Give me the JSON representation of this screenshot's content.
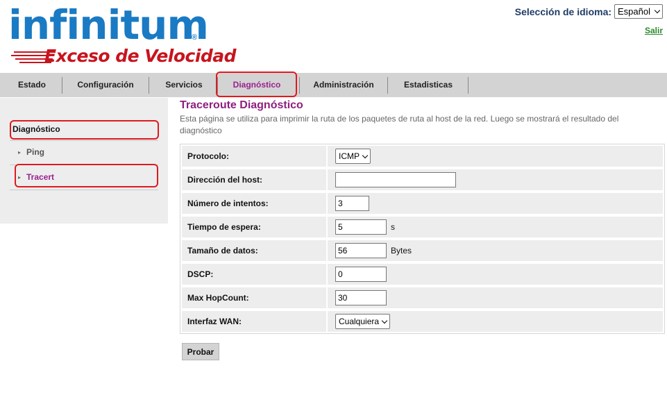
{
  "brand": {
    "name": "infinitum",
    "registered": "®",
    "tagline": "Exceso de Velocidad"
  },
  "language": {
    "label": "Selección de idioma:",
    "selected": "Español"
  },
  "logout_label": "Salir",
  "nav": [
    "Estado",
    "Configuración",
    "Servicios",
    "Diagnóstico",
    "Administración",
    "Estadisticas"
  ],
  "sidebar": {
    "title": "Diagnóstico",
    "items": [
      {
        "label": "Ping"
      },
      {
        "label": "Tracert"
      }
    ]
  },
  "page": {
    "title": "Traceroute Diagnóstico",
    "description": "Esta página se utiliza para imprimir la ruta de los paquetes de ruta al host de la red. Luego se mostrará el resultado del diagnóstico"
  },
  "form": {
    "protocol": {
      "label": "Protocolo:",
      "value": "ICMP"
    },
    "host": {
      "label": "Dirección del host:",
      "value": ""
    },
    "attempts": {
      "label": "Número de intentos:",
      "value": "3"
    },
    "timeout": {
      "label": "Tiempo de espera:",
      "value": "5",
      "unit": "s"
    },
    "data_size": {
      "label": "Tamaño de datos:",
      "value": "56",
      "unit": "Bytes"
    },
    "dscp": {
      "label": "DSCP:",
      "value": "0"
    },
    "max_hop": {
      "label": "Max HopCount:",
      "value": "30"
    },
    "wan_interface": {
      "label": "Interfaz WAN:",
      "value": "Cualquiera"
    }
  },
  "submit_label": "Probar",
  "colors": {
    "brand_blue": "#1a7ac4",
    "brand_red": "#c8141e",
    "accent_purple": "#8e1f7f",
    "highlight_red": "#e0191f"
  }
}
